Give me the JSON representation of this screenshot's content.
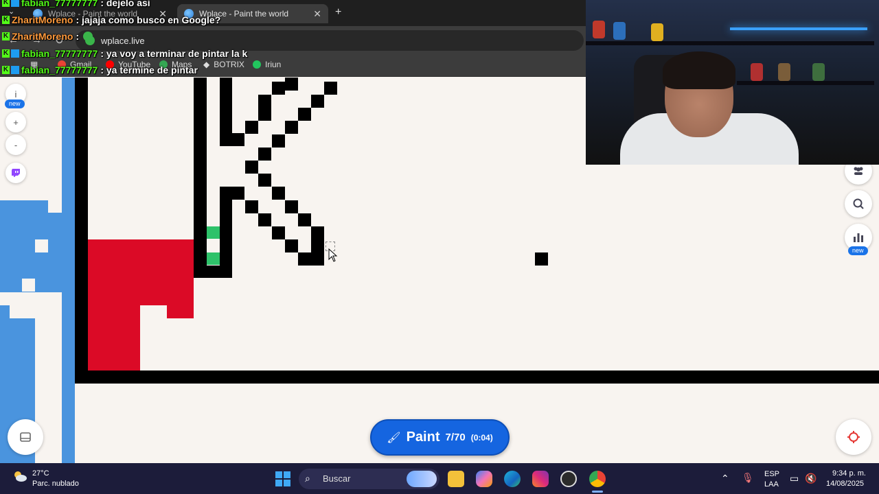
{
  "browser": {
    "tabs": [
      {
        "label": "Wplace - Paint the world",
        "active": false
      },
      {
        "label": "Wplace - Paint the world",
        "active": true
      }
    ],
    "url": "wplace.live",
    "bookmarks": [
      "Gmail",
      "YouTube",
      "Maps",
      "BOTRIX",
      "Iriun"
    ]
  },
  "chat": [
    {
      "user": "fabian_77777777",
      "message": ": dejelo asi",
      "user_color": "#53fc18"
    },
    {
      "user": "ZharitMoreno",
      "message": ": jajaja como busco en Google?",
      "user_color": "#ff9a3c"
    },
    {
      "user": "ZharitMoreno",
      "message": ":",
      "user_color": "#ff9a3c"
    },
    {
      "user": "fabian_77777777",
      "message": ": ya voy a terminar de pintar la k",
      "user_color": "#53fc18"
    },
    {
      "user": "fabian_77777777",
      "message": ": ya termine de pintar",
      "user_color": "#53fc18"
    }
  ],
  "left_controls": {
    "info_label": "i",
    "new_badge": "new",
    "zoom_in": "+",
    "zoom_out": "-"
  },
  "right_controls": {
    "stats_new_badge": "new"
  },
  "paint_button": {
    "label": "Paint",
    "count": "7/70",
    "timer": "(0:04)"
  },
  "canvas_colors": {
    "background": "#f8f4f0",
    "black": "#000000",
    "red": "#db0a26",
    "blue": "#4a94de",
    "green": "#2ec26a"
  },
  "taskbar": {
    "temperature": "27°C",
    "weather": "Parc. nublado",
    "search_placeholder": "Buscar",
    "language": "ESP",
    "layout": "LAA",
    "time": "9:34 p. m.",
    "date": "14/08/2025"
  }
}
